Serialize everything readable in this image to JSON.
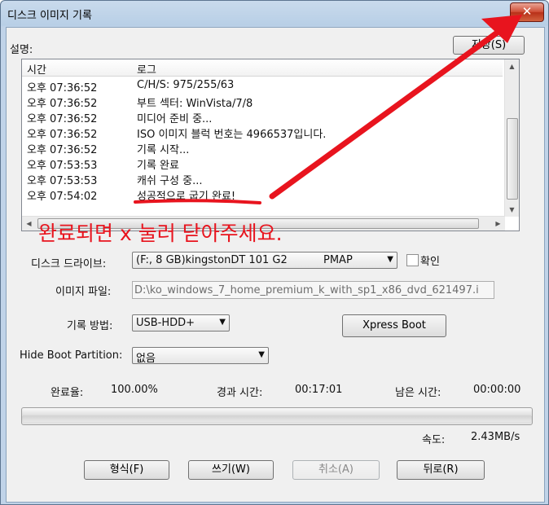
{
  "window": {
    "title": "디스크 이미지 기록",
    "close_glyph": "✕"
  },
  "description_label": "설명:",
  "save_button": "저장(S)",
  "log": {
    "columns": [
      "시간",
      "로그"
    ],
    "rows": [
      {
        "time": "오후 07:36:52",
        "msg": "C/H/S: 975/255/63"
      },
      {
        "time": "오후 07:36:52",
        "msg": "부트 섹터: WinVista/7/8"
      },
      {
        "time": "오후 07:36:52",
        "msg": "미디어 준비 중..."
      },
      {
        "time": "오후 07:36:52",
        "msg": "ISO 이미지 블럭 번호는 4966537입니다."
      },
      {
        "time": "오후 07:36:52",
        "msg": "기록 시작..."
      },
      {
        "time": "오후 07:53:53",
        "msg": "기록 완료"
      },
      {
        "time": "오후 07:53:53",
        "msg": "캐쉬 구성 중..."
      },
      {
        "time": "오후 07:54:02",
        "msg": "성공적으로 굽기 완료!"
      }
    ]
  },
  "annotation": {
    "text": "완료되면 x 눌러 닫아주세요.",
    "color": "#e8141e"
  },
  "drive": {
    "label": "디스크 드라이브:",
    "value": "(F:, 8 GB)kingstonDT 101 G2",
    "value_suffix": "PMAP",
    "verify_label": "확인"
  },
  "image_file": {
    "label": "이미지 파일:",
    "value": "D:\\ko_windows_7_home_premium_k_with_sp1_x86_dvd_621497.i"
  },
  "write_method": {
    "label": "기록 방법:",
    "value": "USB-HDD+"
  },
  "xpress_boot": "Xpress Boot",
  "hide_boot": {
    "label": "Hide Boot Partition:",
    "value": "없음"
  },
  "status": {
    "complete_label": "완료율:",
    "complete_value": "100.00%",
    "elapsed_label": "경과 시간:",
    "elapsed_value": "00:17:01",
    "remaining_label": "남은 시간:",
    "remaining_value": "00:00:00",
    "speed_label": "속도:",
    "speed_value": "2.43MB/s"
  },
  "progress_fraction": 1.0,
  "buttons": {
    "format": "형식(F)",
    "write": "쓰기(W)",
    "cancel": "취소(A)",
    "back": "뒤로(R)"
  }
}
